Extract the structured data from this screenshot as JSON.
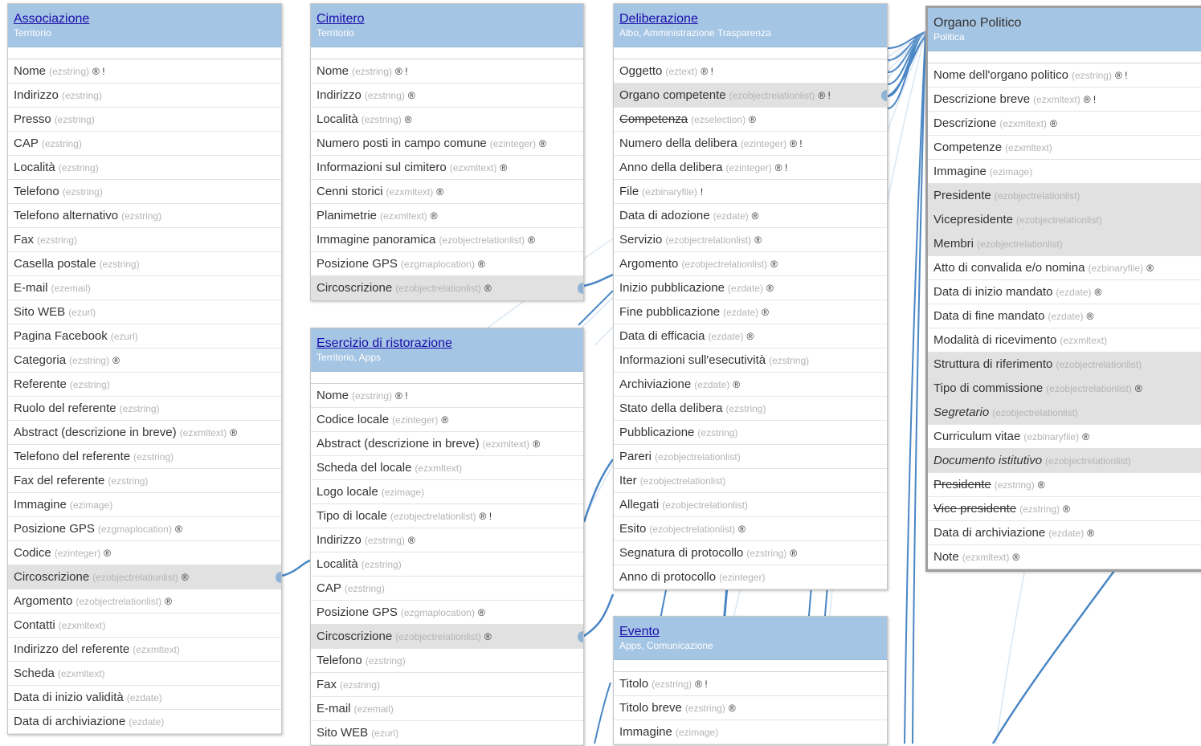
{
  "cards": [
    {
      "title": "Associazione",
      "subtitle": "Territorio",
      "fields": [
        {
          "name": "Nome",
          "type": "(ezstring)",
          "flags": "® !"
        },
        {
          "name": "Indirizzo",
          "type": "(ezstring)",
          "flags": ""
        },
        {
          "name": "Presso",
          "type": "(ezstring)",
          "flags": ""
        },
        {
          "name": "CAP",
          "type": "(ezstring)",
          "flags": ""
        },
        {
          "name": "Località",
          "type": "(ezstring)",
          "flags": ""
        },
        {
          "name": "Telefono",
          "type": "(ezstring)",
          "flags": ""
        },
        {
          "name": "Telefono alternativo",
          "type": "(ezstring)",
          "flags": ""
        },
        {
          "name": "Fax",
          "type": "(ezstring)",
          "flags": ""
        },
        {
          "name": "Casella postale",
          "type": "(ezstring)",
          "flags": ""
        },
        {
          "name": "E-mail",
          "type": "(ezemail)",
          "flags": ""
        },
        {
          "name": "Sito WEB",
          "type": "(ezurl)",
          "flags": ""
        },
        {
          "name": "Pagina Facebook",
          "type": "(ezurl)",
          "flags": ""
        },
        {
          "name": "Categoria",
          "type": "(ezstring)",
          "flags": "®"
        },
        {
          "name": "Referente",
          "type": "(ezstring)",
          "flags": ""
        },
        {
          "name": "Ruolo del referente",
          "type": "(ezstring)",
          "flags": ""
        },
        {
          "name": "Abstract (descrizione in breve)",
          "type": "(ezxmltext)",
          "flags": "®"
        },
        {
          "name": "Telefono del referente",
          "type": "(ezstring)",
          "flags": ""
        },
        {
          "name": "Fax del referente",
          "type": "(ezstring)",
          "flags": ""
        },
        {
          "name": "Immagine",
          "type": "(ezimage)",
          "flags": ""
        },
        {
          "name": "Posizione GPS",
          "type": "(ezgmaplocation)",
          "flags": "®"
        },
        {
          "name": "Codice",
          "type": "(ezinteger)",
          "flags": "®"
        },
        {
          "name": "Circoscrizione",
          "type": "(ezobjectrelationlist)",
          "flags": "®",
          "highlight": true
        },
        {
          "name": "Argomento",
          "type": "(ezobjectrelationlist)",
          "flags": "®"
        },
        {
          "name": "Contatti",
          "type": "(ezxmltext)",
          "flags": ""
        },
        {
          "name": "Indirizzo del referente",
          "type": "(ezxmltext)",
          "flags": ""
        },
        {
          "name": "Scheda",
          "type": "(ezxmltext)",
          "flags": ""
        },
        {
          "name": "Data di inizio validità",
          "type": "(ezdate)",
          "flags": ""
        },
        {
          "name": "Data di archiviazione",
          "type": "(ezdate)",
          "flags": ""
        }
      ]
    },
    {
      "title": "Cimitero",
      "subtitle": "Territorio",
      "fields": [
        {
          "name": "Nome",
          "type": "(ezstring)",
          "flags": "® !"
        },
        {
          "name": "Indirizzo",
          "type": "(ezstring)",
          "flags": "®"
        },
        {
          "name": "Località",
          "type": "(ezstring)",
          "flags": "®"
        },
        {
          "name": "Numero posti in campo comune",
          "type": "(ezinteger)",
          "flags": "®"
        },
        {
          "name": "Informazioni sul cimitero",
          "type": "(ezxmltext)",
          "flags": "®"
        },
        {
          "name": "Cenni storici",
          "type": "(ezxmltext)",
          "flags": "®"
        },
        {
          "name": "Planimetrie",
          "type": "(ezxmltext)",
          "flags": "®"
        },
        {
          "name": "Immagine panoramica",
          "type": "(ezobjectrelationlist)",
          "flags": "®"
        },
        {
          "name": "Posizione GPS",
          "type": "(ezgmaplocation)",
          "flags": "®"
        },
        {
          "name": "Circoscrizione",
          "type": "(ezobjectrelationlist)",
          "flags": "®",
          "highlight": true
        }
      ]
    },
    {
      "title": "Esercizio di ristorazione",
      "subtitle": "Territorio, Apps",
      "fields": [
        {
          "name": "Nome",
          "type": "(ezstring)",
          "flags": "® !"
        },
        {
          "name": "Codice locale",
          "type": "(ezinteger)",
          "flags": "®"
        },
        {
          "name": "Abstract (descrizione in breve)",
          "type": "(ezxmltext)",
          "flags": "®"
        },
        {
          "name": "Scheda del locale",
          "type": "(ezxmltext)",
          "flags": ""
        },
        {
          "name": "Logo locale",
          "type": "(ezimage)",
          "flags": ""
        },
        {
          "name": "Tipo di locale",
          "type": "(ezobjectrelationlist)",
          "flags": "® !"
        },
        {
          "name": "Indirizzo",
          "type": "(ezstring)",
          "flags": "®"
        },
        {
          "name": "Località",
          "type": "(ezstring)",
          "flags": ""
        },
        {
          "name": "CAP",
          "type": "(ezstring)",
          "flags": ""
        },
        {
          "name": "Posizione GPS",
          "type": "(ezgmaplocation)",
          "flags": "®"
        },
        {
          "name": "Circoscrizione",
          "type": "(ezobjectrelationlist)",
          "flags": "®",
          "highlight": true
        },
        {
          "name": "Telefono",
          "type": "(ezstring)",
          "flags": ""
        },
        {
          "name": "Fax",
          "type": "(ezstring)",
          "flags": ""
        },
        {
          "name": "E-mail",
          "type": "(ezemail)",
          "flags": ""
        },
        {
          "name": "Sito WEB",
          "type": "(ezurl)",
          "flags": ""
        }
      ]
    },
    {
      "title": "Deliberazione",
      "subtitle": "Albo, Amministrazione Trasparenza",
      "fields": [
        {
          "name": "Oggetto",
          "type": "(eztext)",
          "flags": "® !"
        },
        {
          "name": "Organo competente",
          "type": "(ezobjectrelationlist)",
          "flags": "® !",
          "highlight": true
        },
        {
          "name": "Competenza",
          "type": "(ezselection)",
          "flags": "®",
          "strike": true
        },
        {
          "name": "Numero della delibera",
          "type": "(ezinteger)",
          "flags": "® !"
        },
        {
          "name": "Anno della delibera",
          "type": "(ezinteger)",
          "flags": "® !"
        },
        {
          "name": "File",
          "type": "(ezbinaryfile)",
          "flags": "!"
        },
        {
          "name": "Data di adozione",
          "type": "(ezdate)",
          "flags": "®"
        },
        {
          "name": "Servizio",
          "type": "(ezobjectrelationlist)",
          "flags": "®"
        },
        {
          "name": "Argomento",
          "type": "(ezobjectrelationlist)",
          "flags": "®"
        },
        {
          "name": "Inizio pubblicazione",
          "type": "(ezdate)",
          "flags": "®"
        },
        {
          "name": "Fine pubblicazione",
          "type": "(ezdate)",
          "flags": "®"
        },
        {
          "name": "Data di efficacia",
          "type": "(ezdate)",
          "flags": "®"
        },
        {
          "name": "Informazioni sull'esecutività",
          "type": "(ezstring)",
          "flags": ""
        },
        {
          "name": "Archiviazione",
          "type": "(ezdate)",
          "flags": "®"
        },
        {
          "name": "Stato della delibera",
          "type": "(ezstring)",
          "flags": ""
        },
        {
          "name": "Pubblicazione",
          "type": "(ezstring)",
          "flags": ""
        },
        {
          "name": "Pareri",
          "type": "(ezobjectrelationlist)",
          "flags": ""
        },
        {
          "name": "Iter",
          "type": "(ezobjectrelationlist)",
          "flags": ""
        },
        {
          "name": "Allegati",
          "type": "(ezobjectrelationlist)",
          "flags": ""
        },
        {
          "name": "Esito",
          "type": "(ezobjectrelationlist)",
          "flags": "®"
        },
        {
          "name": "Segnatura di protocollo",
          "type": "(ezstring)",
          "flags": "®"
        },
        {
          "name": "Anno di protocollo",
          "type": "(ezinteger)",
          "flags": ""
        }
      ]
    },
    {
      "title": "Evento",
      "subtitle": "Apps, Comunicazione",
      "fields": [
        {
          "name": "Titolo",
          "type": "(ezstring)",
          "flags": "® !"
        },
        {
          "name": "Titolo breve",
          "type": "(ezstring)",
          "flags": "®"
        },
        {
          "name": "Immagine",
          "type": "(ezimage)",
          "flags": ""
        }
      ]
    },
    {
      "title": "Organo Politico",
      "subtitle": "Politica",
      "fields": [
        {
          "name": "Nome dell'organo politico",
          "type": "(ezstring)",
          "flags": "® !"
        },
        {
          "name": "Descrizione breve",
          "type": "(ezxmltext)",
          "flags": "® !"
        },
        {
          "name": "Descrizione",
          "type": "(ezxmltext)",
          "flags": "®"
        },
        {
          "name": "Competenze",
          "type": "(ezxmltext)",
          "flags": ""
        },
        {
          "name": "Immagine",
          "type": "(ezimage)",
          "flags": ""
        },
        {
          "name": "Presidente",
          "type": "(ezobjectrelationlist)",
          "flags": "",
          "highlight": true
        },
        {
          "name": "Vicepresidente",
          "type": "(ezobjectrelationlist)",
          "flags": "",
          "highlight": true
        },
        {
          "name": "Membri",
          "type": "(ezobjectrelationlist)",
          "flags": "",
          "highlight": true
        },
        {
          "name": "Atto di convalida e/o nomina",
          "type": "(ezbinaryfile)",
          "flags": "®"
        },
        {
          "name": "Data di inizio mandato",
          "type": "(ezdate)",
          "flags": "®"
        },
        {
          "name": "Data di fine mandato",
          "type": "(ezdate)",
          "flags": "®"
        },
        {
          "name": "Modalità di ricevimento",
          "type": "(ezxmltext)",
          "flags": ""
        },
        {
          "name": "Struttura di riferimento",
          "type": "(ezobjectrelationlist)",
          "flags": "",
          "highlight": true
        },
        {
          "name": "Tipo di commissione",
          "type": "(ezobjectrelationlist)",
          "flags": "®",
          "highlight": true
        },
        {
          "name": "Segretario",
          "type": "(ezobjectrelationlist)",
          "flags": "",
          "highlight": true,
          "italic": true
        },
        {
          "name": "Curriculum vitae",
          "type": "(ezbinaryfile)",
          "flags": "®"
        },
        {
          "name": "Documento istitutivo",
          "type": "(ezobjectrelationlist)",
          "flags": "",
          "highlight": true,
          "italic": true
        },
        {
          "name": "Presidente",
          "type": "(ezstring)",
          "flags": "®",
          "strike": true
        },
        {
          "name": "Vice presidente",
          "type": "(ezstring)",
          "flags": "®",
          "strike": true
        },
        {
          "name": "Data di archiviazione",
          "type": "(ezdate)",
          "flags": "®"
        },
        {
          "name": "Note",
          "type": "(ezxmltext)",
          "flags": "®"
        }
      ]
    }
  ]
}
